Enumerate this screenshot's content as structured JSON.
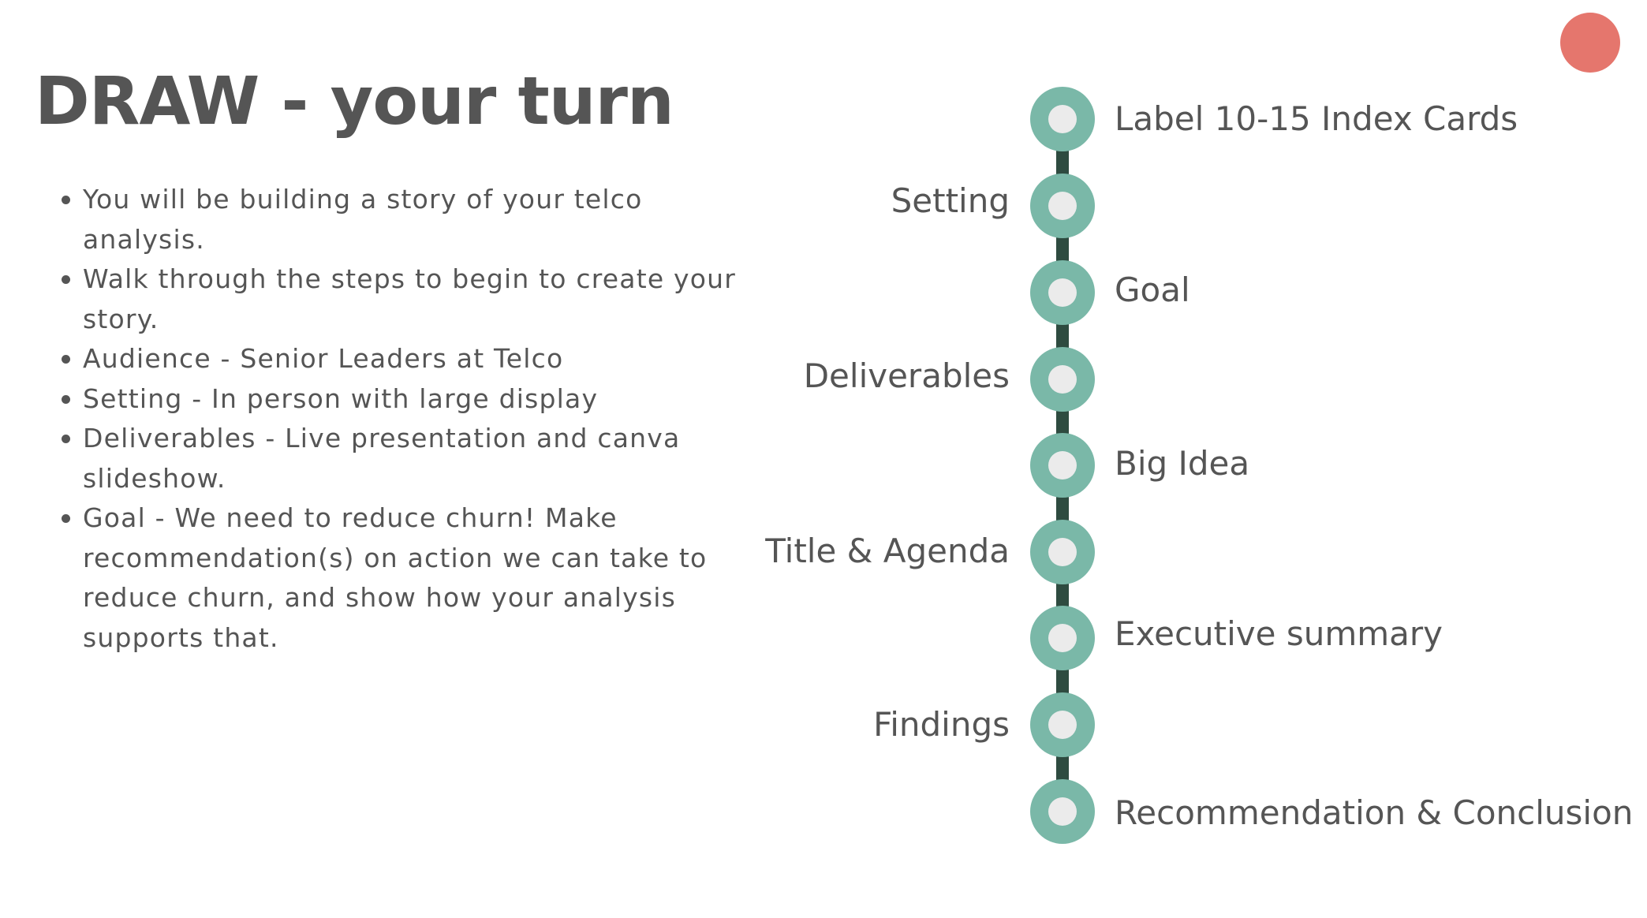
{
  "slide": {
    "title": "DRAW - your turn",
    "bullets": [
      "You will be building a story of your telco analysis.",
      "Walk through the steps to begin to create your story.",
      "Audience - Senior Leaders at Telco",
      "Setting - In person with large display",
      "Deliverables - Live presentation and canva slideshow.",
      "Goal - We need to reduce churn! Make recommendation(s) on action we can take to reduce churn, and show how your analysis supports that."
    ]
  },
  "timeline": {
    "steps": [
      {
        "label": "Label 10-15 Index Cards",
        "side": "right"
      },
      {
        "label": "Setting",
        "side": "left"
      },
      {
        "label": "Goal",
        "side": "right"
      },
      {
        "label": "Deliverables",
        "side": "left"
      },
      {
        "label": "Big Idea",
        "side": "right"
      },
      {
        "label": "Title & Agenda",
        "side": "left"
      },
      {
        "label": "Executive summary",
        "side": "right"
      },
      {
        "label": "Findings",
        "side": "left"
      },
      {
        "label": "Recommendation & Conclusion",
        "side": "right"
      }
    ]
  },
  "colors": {
    "text": "#555555",
    "node_ring": "#7ab8a8",
    "node_center": "#ebebeb",
    "timeline_line": "#2e4b40",
    "accent_dot": "#e5766d"
  }
}
